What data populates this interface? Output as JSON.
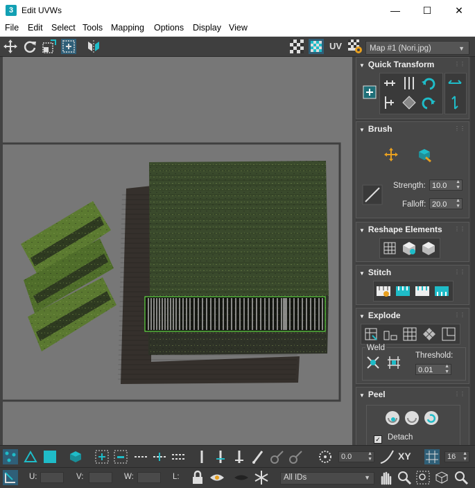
{
  "window": {
    "title": "Edit UVWs",
    "app_icon_text": "3"
  },
  "menu": [
    "File",
    "Edit",
    "Select",
    "Tools",
    "Mapping",
    "Options",
    "Display",
    "View"
  ],
  "toolbar": {
    "uv_label": "UV",
    "map_select": "Map #1 (Nori.jpg)"
  },
  "rollouts": {
    "quick_transform": "Quick Transform",
    "brush": {
      "title": "Brush",
      "strength_label": "Strength:",
      "strength_value": "10.0",
      "falloff_label": "Falloff:",
      "falloff_value": "20.0"
    },
    "reshape": "Reshape Elements",
    "stitch": "Stitch",
    "explode": {
      "title": "Explode",
      "weld_label": "Weld",
      "threshold_label": "Threshold:",
      "threshold_value": "0.01"
    },
    "peel": {
      "title": "Peel",
      "detach_label": "Detach",
      "detach_checked": true
    }
  },
  "bottom": {
    "rotation_value": "0.0",
    "xy_label": "XY",
    "grid_value": "16",
    "u_label": "U:",
    "v_label": "V:",
    "w_label": "W:",
    "l_label": "L:",
    "ids_select": "All IDs"
  },
  "colors": {
    "accent": "#1fbcc8",
    "selection": "#6cff4a",
    "panel_bg": "#474747"
  }
}
